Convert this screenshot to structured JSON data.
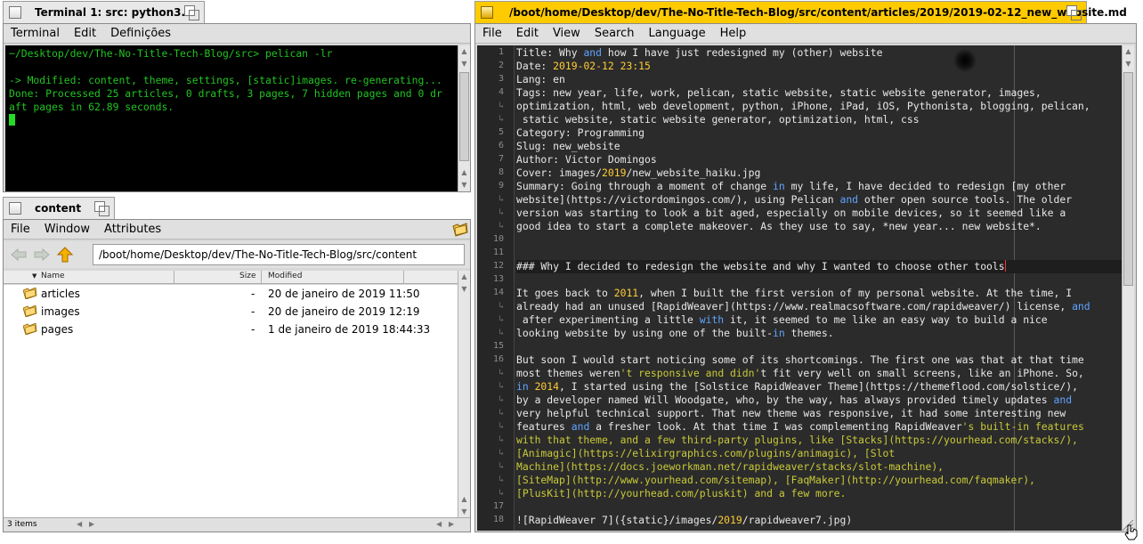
{
  "terminal": {
    "tab_title": "Terminal 1: src: python3.6",
    "menu": [
      "Terminal",
      "Edit",
      "Definições"
    ],
    "lines": [
      "~/Desktop/dev/The-No-Title-Tech-Blog/src> pelican -lr",
      "",
      "-> Modified: content, theme, settings, [static]images. re-generating...",
      "Done: Processed 25 articles, 0 drafts, 3 pages, 7 hidden pages and 0 dr",
      "aft pages in 62.89 seconds."
    ],
    "colors": {
      "text": "#22c322",
      "background": "#000000"
    }
  },
  "tracker": {
    "tab_title": "content",
    "menu": [
      "File",
      "Window",
      "Attributes"
    ],
    "path": "/boot/home/Desktop/dev/The-No-Title-Tech-Blog/src/content",
    "columns": {
      "name": "Name",
      "size": "Size",
      "modified": "Modified"
    },
    "files": [
      {
        "name": "articles",
        "size": "-",
        "modified": "20 de janeiro de 2019 11:50",
        "icon": "folder-icon"
      },
      {
        "name": "images",
        "size": "-",
        "modified": "20 de janeiro de 2019 12:19",
        "icon": "folder-icon"
      },
      {
        "name": "pages",
        "size": "-",
        "modified": "1 de janeiro de 2019 18:44:33",
        "icon": "folder-icon"
      }
    ],
    "status": "3 items"
  },
  "editor": {
    "tab_title": "/boot/home/Desktop/dev/The-No-Title-Tech-Blog/src/content/articles/2019/2019-02-12_new_website.md",
    "menu": [
      "File",
      "Edit",
      "View",
      "Search",
      "Language",
      "Help"
    ],
    "colors": {
      "background": "#2b2b2b",
      "keyword": "#5fa3ff",
      "number": "#ffcc33",
      "string": "#c9c93a",
      "cursor": "#ff3030"
    },
    "lines": [
      {
        "n": "1",
        "segs": [
          [
            "Title: Why ",
            ""
          ],
          [
            "and",
            "kw"
          ],
          [
            " how I have just redesigned my (other) website",
            ""
          ]
        ]
      },
      {
        "n": "2",
        "segs": [
          [
            "Date: ",
            ""
          ],
          [
            "2019-02-12 23:15",
            "num"
          ]
        ]
      },
      {
        "n": "3",
        "segs": [
          [
            "Lang: en",
            ""
          ]
        ]
      },
      {
        "n": "4",
        "segs": [
          [
            "Tags: new year, life, work, pelican, static website, static website generator, images,",
            ""
          ]
        ]
      },
      {
        "n": "wrap",
        "segs": [
          [
            "optimization, html, web development, python, iPhone, iPad, iOS, Pythonista, blogging, pelican,",
            ""
          ]
        ]
      },
      {
        "n": "wrap",
        "segs": [
          [
            " static website, static website generator, optimization, html, css",
            ""
          ]
        ]
      },
      {
        "n": "5",
        "segs": [
          [
            "Category: Programming",
            ""
          ]
        ]
      },
      {
        "n": "6",
        "segs": [
          [
            "Slug: new_website",
            ""
          ]
        ]
      },
      {
        "n": "7",
        "segs": [
          [
            "Author: Victor Domingos",
            ""
          ]
        ]
      },
      {
        "n": "8",
        "segs": [
          [
            "Cover: images/",
            ""
          ],
          [
            "2019",
            "num"
          ],
          [
            "/new_website_haiku.jpg",
            ""
          ]
        ]
      },
      {
        "n": "9",
        "segs": [
          [
            "Summary: Going through a moment of change ",
            ""
          ],
          [
            "in",
            "kw"
          ],
          [
            " my life, I have decided to redesign [my other",
            ""
          ]
        ]
      },
      {
        "n": "wrap",
        "segs": [
          [
            "website](https://victordomingos.com/), using Pelican ",
            ""
          ],
          [
            "and",
            "kw"
          ],
          [
            " other open source tools. The older",
            ""
          ]
        ]
      },
      {
        "n": "wrap",
        "segs": [
          [
            "version was starting to look a bit aged, especially on mobile devices, so it seemed like a",
            ""
          ]
        ]
      },
      {
        "n": "wrap",
        "segs": [
          [
            "good idea to start a complete makeover. As they use to say, *new year... new website*.",
            ""
          ]
        ]
      },
      {
        "n": "10",
        "segs": []
      },
      {
        "n": "11",
        "segs": []
      },
      {
        "n": "12",
        "segs": [
          [
            "### Why I decided to redesign the website and why I wanted to choose other tools",
            ""
          ]
        ],
        "current": true
      },
      {
        "n": "13",
        "segs": []
      },
      {
        "n": "14",
        "segs": [
          [
            "It goes back to ",
            ""
          ],
          [
            "2011",
            "num"
          ],
          [
            ", when I built the first version of my personal website. At the time, I",
            ""
          ]
        ]
      },
      {
        "n": "wrap",
        "segs": [
          [
            "already had an unused [RapidWeaver](https://www.realmacsoftware.com/rapidweaver/) license, ",
            ""
          ],
          [
            "and",
            "kw"
          ]
        ]
      },
      {
        "n": "wrap",
        "segs": [
          [
            " after experimenting a little ",
            ""
          ],
          [
            "with",
            "kw"
          ],
          [
            " it, it seemed to me like an easy way to build a nice",
            ""
          ]
        ]
      },
      {
        "n": "wrap",
        "segs": [
          [
            "looking website by using one of the built-",
            ""
          ],
          [
            "in",
            "kw"
          ],
          [
            " themes.",
            ""
          ]
        ]
      },
      {
        "n": "15",
        "segs": []
      },
      {
        "n": "16",
        "segs": [
          [
            "But soon I would start noticing some of its shortcomings. The first one was that at that time",
            ""
          ]
        ]
      },
      {
        "n": "wrap",
        "segs": [
          [
            "most themes weren",
            ""
          ],
          [
            "'t responsive and didn'",
            "str"
          ],
          [
            "t fit very well on small screens, like an iPhone. So,",
            ""
          ]
        ]
      },
      {
        "n": "wrap",
        "segs": [
          [
            "in",
            "kw"
          ],
          [
            " ",
            ""
          ],
          [
            "2014",
            "num"
          ],
          [
            ", I started using the [Solstice RapidWeaver Theme](https://themeflood.com/solstice/),",
            ""
          ]
        ]
      },
      {
        "n": "wrap",
        "segs": [
          [
            "by a developer named Will Woodgate, who, by the way, has always provided timely updates ",
            ""
          ],
          [
            "and",
            "kw"
          ]
        ]
      },
      {
        "n": "wrap",
        "segs": [
          [
            "very helpful technical support. That new theme was responsive, it had some interesting new",
            ""
          ]
        ]
      },
      {
        "n": "wrap",
        "segs": [
          [
            "features ",
            ""
          ],
          [
            "and",
            "kw"
          ],
          [
            " a fresher look. At that time I was complementing RapidWeaver",
            ""
          ],
          [
            "'s built-in features",
            "str"
          ]
        ]
      },
      {
        "n": "wrap",
        "segs": [
          [
            "with that theme, and a few third-party plugins, like [Stacks](https://yourhead.com/stacks/),",
            "str"
          ]
        ]
      },
      {
        "n": "wrap",
        "segs": [
          [
            "[Animagic](https://elixirgraphics.com/plugins/animagic), [Slot",
            "str"
          ]
        ]
      },
      {
        "n": "wrap",
        "segs": [
          [
            "Machine](https://docs.joeworkman.net/rapidweaver/stacks/slot-machine),",
            "str"
          ]
        ]
      },
      {
        "n": "wrap",
        "segs": [
          [
            "[SiteMap](http://www.yourhead.com/sitemap), [FaqMaker](http://yourhead.com/faqmaker),",
            "str"
          ]
        ]
      },
      {
        "n": "wrap",
        "segs": [
          [
            "[PlusKit](http://yourhead.com/pluskit) and a few more.",
            "str"
          ]
        ]
      },
      {
        "n": "17",
        "segs": []
      },
      {
        "n": "18",
        "segs": [
          [
            "![RapidWeaver 7]({static}/images/",
            ""
          ],
          [
            "2019",
            "num"
          ],
          [
            "/rapidweaver7.jpg)",
            ""
          ]
        ]
      }
    ]
  }
}
